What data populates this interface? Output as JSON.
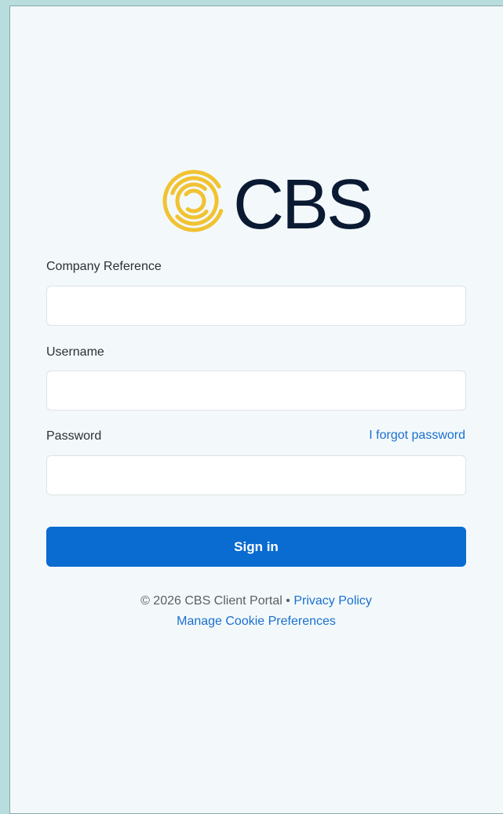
{
  "brand": {
    "logo_text": "CBS",
    "colors": {
      "ring": "#f1c232",
      "wordmark": "#0b1a33"
    }
  },
  "form": {
    "company_reference": {
      "label": "Company Reference",
      "value": "",
      "placeholder": ""
    },
    "username": {
      "label": "Username",
      "value": "",
      "placeholder": ""
    },
    "password": {
      "label": "Password",
      "value": "",
      "placeholder": ""
    },
    "forgot_password": "I forgot password",
    "sign_in": "Sign in"
  },
  "footer": {
    "copyright": "© 2026 CBS Client Portal",
    "separator": "•",
    "privacy_policy": "Privacy Policy",
    "cookie_preferences": "Manage Cookie Preferences"
  },
  "colors": {
    "primary": "#0a6bd1",
    "link": "#1a6fd0",
    "background": "#f3f9fa"
  }
}
